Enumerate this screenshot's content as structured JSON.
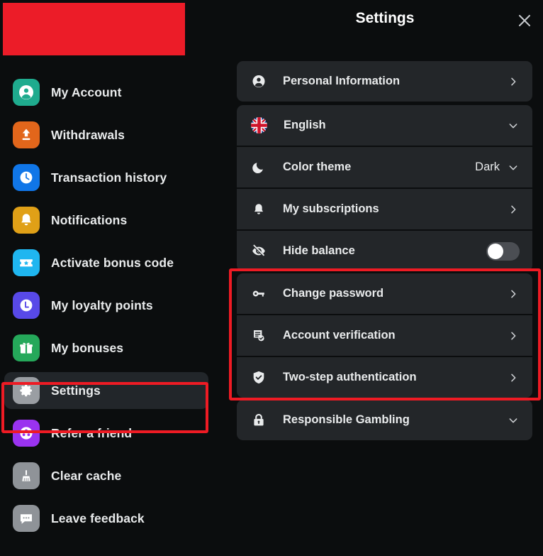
{
  "sidebar": {
    "redaction_color": "#ec1c28",
    "items": [
      {
        "label": "My Account",
        "icon": "person-icon",
        "icon_color": "#1fab8e",
        "active": false
      },
      {
        "label": "Withdrawals",
        "icon": "upload-arrow-icon",
        "icon_color": "#e2661b",
        "active": false
      },
      {
        "label": "Transaction history",
        "icon": "clock-icon",
        "icon_color": "#1076e8",
        "active": false
      },
      {
        "label": "Notifications",
        "icon": "bell-icon",
        "icon_color": "#e0a017",
        "active": false
      },
      {
        "label": "Activate bonus code",
        "icon": "ticket-star-icon",
        "icon_color": "#1fb6f0",
        "active": false
      },
      {
        "label": "My loyalty points",
        "icon": "loyalty-l-icon",
        "icon_color": "#5849e8",
        "active": false
      },
      {
        "label": "My bonuses",
        "icon": "gift-icon",
        "icon_color": "#25a85a",
        "active": false
      },
      {
        "label": "Settings",
        "icon": "gear-icon",
        "icon_color": "#9a9ea3",
        "active": true
      },
      {
        "label": "Refer a friend",
        "icon": "refer-friend-icon",
        "icon_color": "#9a33f0",
        "active": false
      },
      {
        "label": "Clear cache",
        "icon": "broom-icon",
        "icon_color": "#8f9398",
        "active": false
      },
      {
        "label": "Leave feedback",
        "icon": "chat-bubble-icon",
        "icon_color": "#8f9398",
        "active": false
      }
    ]
  },
  "panel": {
    "title": "Settings",
    "close_label": "close-icon",
    "rows": [
      {
        "label": "Personal Information",
        "icon": "person-circle-icon",
        "control": "chevron-right",
        "value": ""
      },
      {
        "label": "English",
        "icon": "uk-flag-icon",
        "control": "chevron-down",
        "value": ""
      },
      {
        "label": "Color theme",
        "icon": "moon-icon",
        "control": "chevron-down",
        "value": "Dark"
      },
      {
        "label": "My subscriptions",
        "icon": "bell-outline-icon",
        "control": "chevron-right",
        "value": ""
      },
      {
        "label": "Hide balance",
        "icon": "eye-off-icon",
        "control": "toggle",
        "value": "",
        "toggle_on": false
      },
      {
        "label": "Change password",
        "icon": "key-icon",
        "control": "chevron-right",
        "value": ""
      },
      {
        "label": "Account verification",
        "icon": "document-check-icon",
        "control": "chevron-right",
        "value": ""
      },
      {
        "label": "Two-step authentication",
        "icon": "shield-check-icon",
        "control": "chevron-right",
        "value": ""
      },
      {
        "label": "Responsible Gambling",
        "icon": "lock-icon",
        "control": "chevron-down",
        "value": ""
      }
    ]
  },
  "annotations": {
    "highlight_color": "#ee1b24",
    "sidebar_highlight_target": "Settings",
    "panel_highlight_targets": [
      "Change password",
      "Account verification",
      "Two-step authentication"
    ]
  }
}
